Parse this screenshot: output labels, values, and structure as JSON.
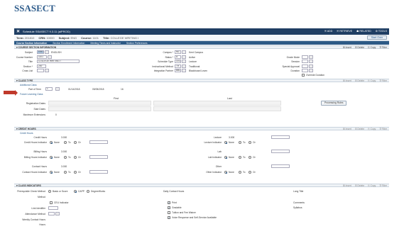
{
  "page_title": "SSASECT",
  "header": {
    "title": "Schedule SSASECT 9.3.11 (alPROD)",
    "add": "ADD",
    "retrieve": "RETRIEVE",
    "related": "RELATED",
    "tools": "TOOLS"
  },
  "key": {
    "term_label": "Term:",
    "term": "201810",
    "crn_label": "CRN:",
    "crn": "10000",
    "subject_label": "Subject:",
    "subject": "ENG",
    "course_label": "Course:",
    "course": "1101",
    "title_label": "Title:",
    "title": "COLLEGE WRITING I",
    "start_over": "Start Over"
  },
  "tabs": [
    "Course Section Information",
    "Section Enrollment Information",
    "Meeting Times and Instructor",
    "Section Preferences"
  ],
  "sections": {
    "course_section": "COURSE SECTION INFORMATION",
    "class_type": "CLASS TYPE",
    "credit_hours": "CREDIT HOURS",
    "class_indicators": "CLASS INDICATORS"
  },
  "actions": {
    "insert": "Insert",
    "delete": "Delete",
    "copy": "Copy",
    "filter": "Filter"
  },
  "course_section": {
    "subject_label": "Subject",
    "subject": "ENG",
    "subject_desc": "ENGLISH",
    "course_number_label": "Course Number",
    "course_number": "1101",
    "title_label": "Title",
    "title": "COLLEGE WRITING I",
    "section_label": "Section *",
    "section": "200",
    "cross_list_label": "Cross List",
    "campus_label": "Campus *",
    "campus": "MC",
    "campus_desc": "Kent Campus",
    "status_label": "Status *",
    "status": "A",
    "status_desc": "Active",
    "schedule_type_label": "Schedule Type",
    "schedule_type": "LEC",
    "schedule_type_desc": "Lecture",
    "instr_method_label": "Instructional Method",
    "instr_method": "TR",
    "instr_method_desc": "Traditional",
    "integration_label": "Integration Partner",
    "integration": "BBL",
    "integration_desc": "Blackboard Learn",
    "grade_mode_label": "Grade Mode",
    "session_label": "Session",
    "special_approval_label": "Special Approval",
    "duration_label": "Duration",
    "override_label": "Override Duration"
  },
  "class_type": {
    "subhead": "Additional Class",
    "part_of_term_label": "Part of Term",
    "part_of_term": "1",
    "start": "01/14/2018",
    "end": "05/05/2018",
    "weeks": "16",
    "future_label": "Future Learning Class",
    "first_label": "First",
    "last_label": "Last",
    "registration_label": "Registration Dates",
    "processing_rules": "Processing Rules",
    "start_dates_label": "Start Dates",
    "max_ext_label": "Maximum Extensions",
    "max_ext": "0"
  },
  "credit_hours": {
    "subhead": "Credit Hours",
    "credit_hours_label": "Credit Hours",
    "credit_hours": "3.000",
    "credit_indicator_label": "Credit Hours Indicator",
    "billing_hours_label": "Billing Hours",
    "billing_hours": "3.000",
    "billing_indicator_label": "Billing Hours Indicator",
    "contact_hours_label": "Contact Hours",
    "contact_hours": "3.000",
    "contact_indicator_label": "Contact Hours Indicator",
    "lecture_label": "Lecture",
    "lecture": "3.000",
    "lecture_indicator_label": "Lecture Indicator",
    "lab_label": "Lab",
    "lab_indicator_label": "Lab Indicator",
    "other_label": "Other",
    "other_indicator_label": "Other Indicator",
    "none": "None",
    "to": "To",
    "or": "Or"
  },
  "indicators": {
    "prereq_label": "Prerequisite Check Method",
    "basis_label": "Basis or Score",
    "cappp_label": "CAPP",
    "degreeworks_label": "DegreeWorks",
    "ceu_label": "CEU Indicator",
    "link_id_label": "Link Identifier",
    "attendance_label": "Attendance Method",
    "weekly_label": "Weekly Contact Hours",
    "daily_label": "Daily Contact Hours",
    "print_label": "Print",
    "gradable_label": "Gradable",
    "tuition_label": "Tuition and Fee Waiver",
    "voice_label": "Voice Response and Self-Service Available",
    "long_title_label": "Long Title",
    "comments_label": "Comments",
    "syllabus_label": "Syllabus"
  }
}
